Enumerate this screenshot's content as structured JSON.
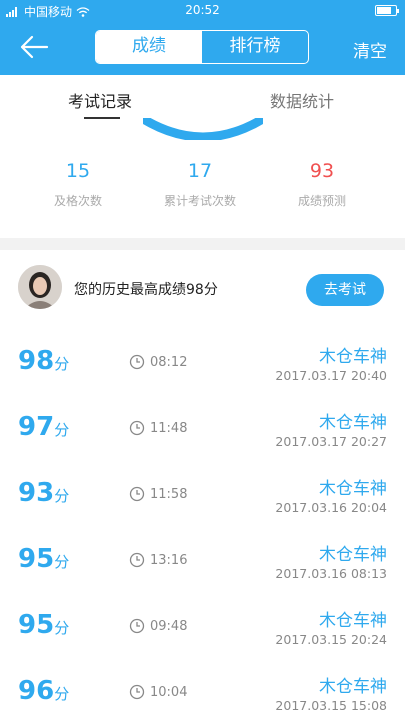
{
  "status": {
    "carrier": "中国移动",
    "time": "20:52"
  },
  "nav": {
    "tabs": [
      "成绩",
      "排行榜"
    ],
    "active_tab": 0,
    "clear_label": "清空"
  },
  "subtabs": {
    "exam_record": "考试记录",
    "data_stats": "数据统计"
  },
  "stats": [
    {
      "value": "15",
      "label": "及格次数"
    },
    {
      "value": "17",
      "label": "累计考试次数"
    },
    {
      "value": "93",
      "label": "成绩预测"
    }
  ],
  "best": {
    "text": "您的历史最高成绩98分",
    "button": "去考试"
  },
  "unit": "分",
  "records": [
    {
      "score": "98",
      "duration": "08:12",
      "user": "木仓车神",
      "date": "2017.03.17  20:40"
    },
    {
      "score": "97",
      "duration": "11:48",
      "user": "木仓车神",
      "date": "2017.03.17  20:27"
    },
    {
      "score": "93",
      "duration": "11:58",
      "user": "木仓车神",
      "date": "2017.03.16  20:04"
    },
    {
      "score": "95",
      "duration": "13:16",
      "user": "木仓车神",
      "date": "2017.03.16  08:13"
    },
    {
      "score": "95",
      "duration": "09:48",
      "user": "木仓车神",
      "date": "2017.03.15  20:24"
    },
    {
      "score": "96",
      "duration": "10:04",
      "user": "木仓车神",
      "date": "2017.03.15  15:08"
    }
  ],
  "colors": {
    "brand": "#2fa9ee",
    "prediction": "#f05050"
  }
}
